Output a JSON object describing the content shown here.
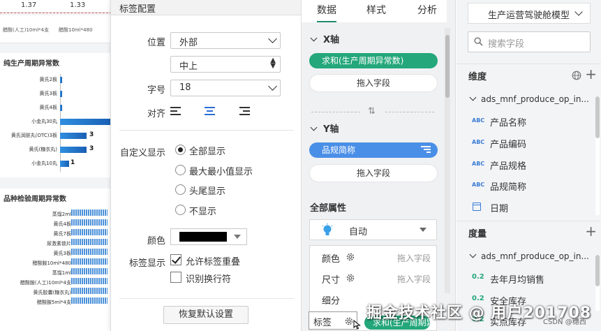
{
  "canvas": {
    "top_values": [
      "1.37",
      "1.33"
    ],
    "legend_items": [
      "醋酸(人工)10ml*4支",
      "醋酸10ml*480"
    ],
    "chart1": {
      "title": "纯生产周期异常数",
      "categories": [
        "黄氏2板",
        "黄氏3板",
        "黄氏4板",
        "小金丸30丸",
        "黄氏润肤丸(OTC)3板",
        "黄氏(糖衣丸)",
        "小金丸10丸"
      ],
      "value_labels": [
        "",
        "",
        "",
        "",
        "3",
        "3",
        "1"
      ]
    },
    "chart2": {
      "title": "品种检验周期异常数",
      "categories": [
        "蒸馏2ml",
        "黄氏4板",
        "黄氏7板",
        "尿激素锁片",
        "黄氏3板",
        "醋酸胺10ml*480",
        "蒸馏1ml",
        "醋酸胺(人工)10ml*4支",
        "黄氏胶囊(糖衣丸)",
        "醋酸胺5ml*4支"
      ]
    }
  },
  "label_config": {
    "header": "标签配置",
    "position_label": "位置",
    "position_value": "外部",
    "sub_position_value": "中上",
    "font_size_label": "字号",
    "font_size_value": "18",
    "align_label": "对齐",
    "custom_display_label": "自定义显示",
    "display_options": [
      {
        "label": "全部显示",
        "selected": true
      },
      {
        "label": "最大最小值显示",
        "selected": false
      },
      {
        "label": "头尾显示",
        "selected": false
      },
      {
        "label": "不显示",
        "selected": false
      }
    ],
    "color_label": "颜色",
    "color_value": "#000000",
    "label_display_label": "标签显示",
    "checkboxes": [
      {
        "label": "允许标签重叠",
        "checked": true
      },
      {
        "label": "识别换行符",
        "checked": false
      }
    ],
    "reset_button": "恢复默认设置"
  },
  "field_panel": {
    "tabs": [
      "数据",
      "样式",
      "分析"
    ],
    "active_tab": "数据",
    "x_axis_title": "X轴",
    "x_field": "求和(生产周期异常数)",
    "drop_field": "拖入字段",
    "y_axis_title": "Y轴",
    "y_field": "品规简称",
    "all_props_title": "全部属性",
    "auto_label": "自动",
    "props": [
      {
        "name": "颜色",
        "drop": "拖入字段"
      },
      {
        "name": "尺寸",
        "drop": "拖入字段"
      },
      {
        "name": "细分",
        "drop": ""
      },
      {
        "name": "标签",
        "drop": ""
      }
    ],
    "label_chip": "求和(生产周期异常数)"
  },
  "right_panel": {
    "model_name": "生产运营驾驶舱模型",
    "search_placeholder": "搜索字段",
    "dimension_title": "维度",
    "measure_title": "度量",
    "table_name": "ads_mnf_produce_op_in...",
    "dimension_fields": [
      {
        "type": "ABC",
        "name": "产品名称"
      },
      {
        "type": "ABC",
        "name": "产品编码"
      },
      {
        "type": "ABC",
        "name": "产品规格"
      },
      {
        "type": "ABC",
        "name": "品规简称"
      },
      {
        "type": "date",
        "name": "日期"
      }
    ],
    "measure_table_name": "ads_mnf_produce_op_in...",
    "measure_fields": [
      {
        "type": "0.2",
        "name": "去年月均销售"
      },
      {
        "type": "0.2",
        "name": "安全库存"
      },
      {
        "type": "0.2",
        "name": "实点库存"
      }
    ]
  },
  "watermark": "掘金技术社区 @ 用户201708",
  "csdn_mark": "CSDN @穗西"
}
